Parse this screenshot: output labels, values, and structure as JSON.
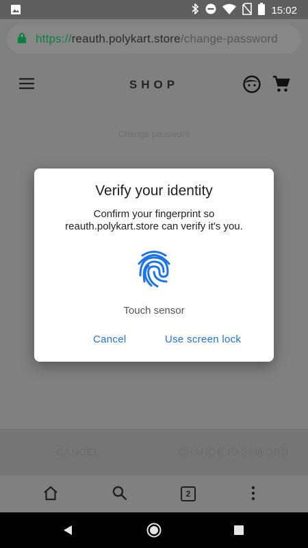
{
  "status_bar": {
    "time": "15:02",
    "icons": [
      "image-icon",
      "bluetooth-icon",
      "do-not-disturb-icon",
      "wifi-icon",
      "no-sim-icon",
      "battery-icon"
    ]
  },
  "url_bar": {
    "scheme": "https://",
    "host": "reauth.polykart.store",
    "path": "/change-password",
    "secure": true
  },
  "shop": {
    "title": "SHOP",
    "subtitle": "Change password",
    "cancel_label": "CANCEL",
    "change_password_label": "CHANGE PASSWORD"
  },
  "dialog": {
    "title": "Verify your identity",
    "message_line1": "Confirm your fingerprint so",
    "message_line2": "reauth.polykart.store can verify it's you.",
    "sensor_label": "Touch sensor",
    "cancel_label": "Cancel",
    "screen_lock_label": "Use screen lock",
    "accent_color": "#1a73e8"
  },
  "browser_toolbar": {
    "tab_count": "2"
  },
  "colors": {
    "scrim": "#808080",
    "secure_green": "#0b8043",
    "nav_bar": "#000000"
  }
}
